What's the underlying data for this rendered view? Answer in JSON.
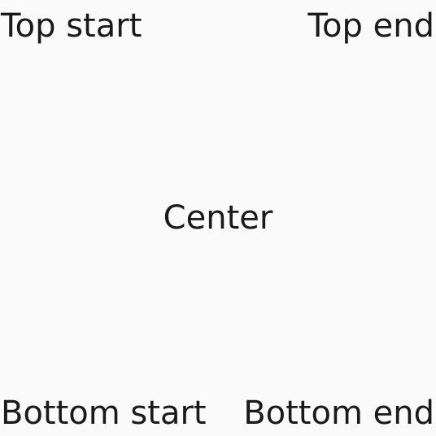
{
  "labels": {
    "top_start": "Top start",
    "top_end": "Top end",
    "center": "Center",
    "bottom_start": "Bottom start",
    "bottom_end": "Bottom end"
  },
  "colors": {
    "background": "#fafafa",
    "text": "#1a1a1a"
  }
}
